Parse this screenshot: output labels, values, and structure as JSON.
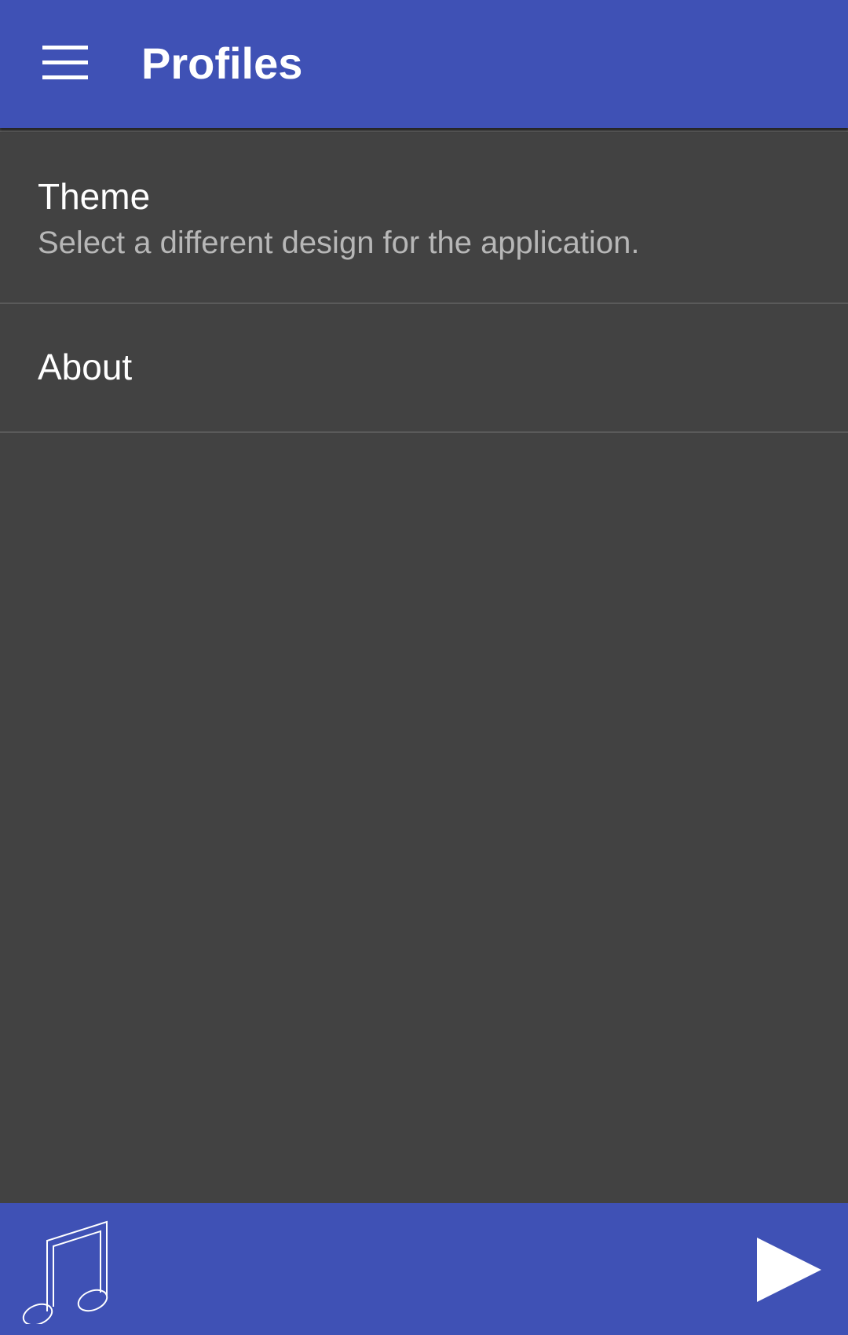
{
  "app": {
    "title": "Profiles",
    "accent_color": "#3f51b5",
    "background_color": "#424242"
  },
  "toolbar": {
    "menu_icon": "hamburger-menu-icon",
    "title": "Profiles"
  },
  "settings": {
    "items": [
      {
        "title": "Theme",
        "summary": "Select a different design for the application."
      },
      {
        "title": "About"
      }
    ]
  },
  "bottom_bar": {
    "left_icon": "music-note-icon",
    "right_icon": "play-icon"
  }
}
